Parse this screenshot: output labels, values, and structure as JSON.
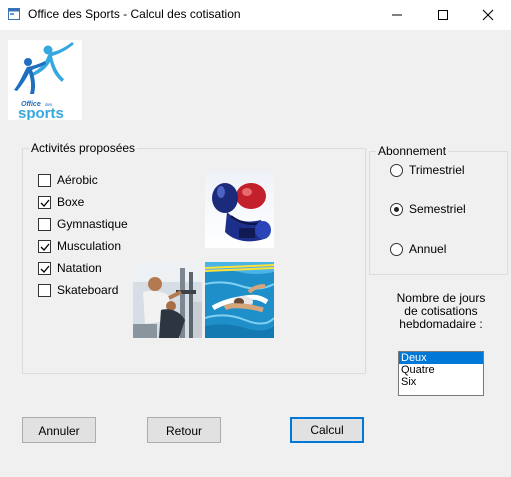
{
  "window": {
    "title": "Office des Sports - Calcul des cotisation",
    "controls": {
      "minimize": "minimize-icon",
      "maximize": "maximize-icon",
      "close": "close-icon"
    }
  },
  "logo": {
    "brand_small": "Office",
    "brand_tiny": "des",
    "brand_large": "sports"
  },
  "activities": {
    "group_label": "Activités proposées",
    "items": [
      {
        "label": "Aérobic",
        "checked": false
      },
      {
        "label": "Boxe",
        "checked": true
      },
      {
        "label": "Gymnastique",
        "checked": false
      },
      {
        "label": "Musculation",
        "checked": true
      },
      {
        "label": "Natation",
        "checked": true
      },
      {
        "label": "Skateboard",
        "checked": false
      }
    ],
    "images": [
      "boxing-gloves",
      "weight-training",
      "swimmer"
    ]
  },
  "subscription": {
    "group_label": "Abonnement",
    "options": [
      {
        "label": "Trimestriel",
        "selected": false
      },
      {
        "label": "Semestriel",
        "selected": true
      },
      {
        "label": "Annuel",
        "selected": false
      }
    ]
  },
  "days": {
    "label_lines": [
      "Nombre de jours",
      "de cotisations",
      "hebdomadaire :"
    ],
    "options": [
      "Deux",
      "Quatre",
      "Six"
    ],
    "selected": "Deux"
  },
  "buttons": {
    "cancel": "Annuler",
    "back": "Retour",
    "calc": "Calcul"
  },
  "colors": {
    "accent": "#0078d7",
    "logo_blue": "#1e6fc0"
  }
}
